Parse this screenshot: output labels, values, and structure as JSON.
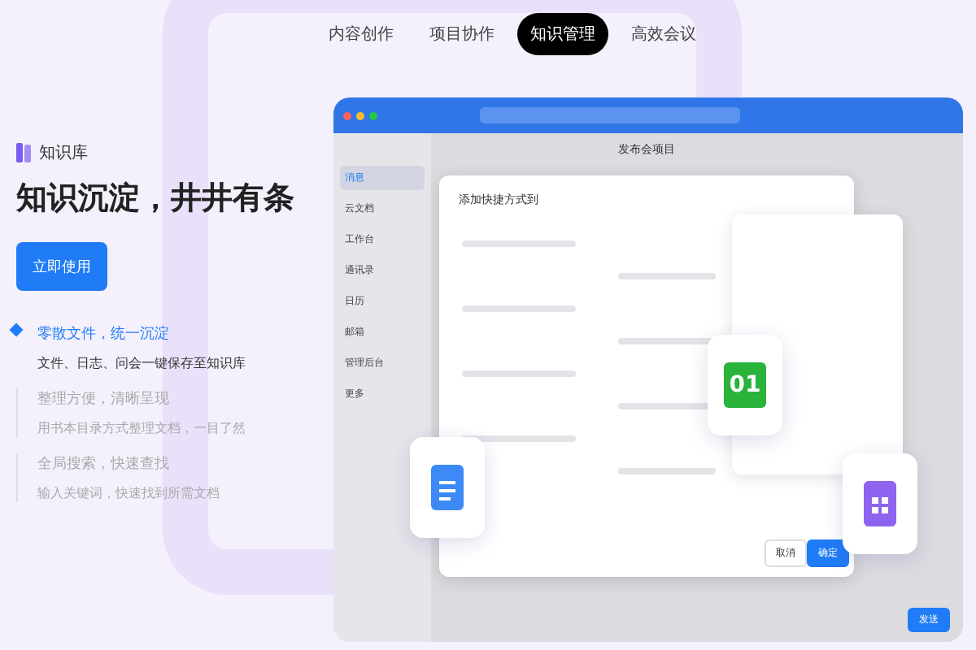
{
  "nav": [
    {
      "label": "内容创作",
      "selected": false
    },
    {
      "label": "项目协作",
      "selected": false
    },
    {
      "label": "知识管理",
      "selected": true
    },
    {
      "label": "高效会议",
      "selected": false
    }
  ],
  "product": {
    "name": "知识库"
  },
  "headline": "知识沉淀，井井有条",
  "cta": "立即使用",
  "features": [
    {
      "title": "零散文件，统一沉淀",
      "desc": "文件、日志、问会一键保存至知识库",
      "selected": true
    },
    {
      "title": "整理方便，清晰呈现",
      "desc": "用书本目录方式整理文档，一目了然",
      "selected": false
    },
    {
      "title": "全局搜索，快速查找",
      "desc": "输入关键词，快速找到所需文档",
      "selected": false
    }
  ],
  "app": {
    "sidebar": [
      {
        "label": "消息",
        "selected": true
      },
      {
        "label": "云文档",
        "selected": false
      },
      {
        "label": "工作台",
        "selected": false
      },
      {
        "label": "通讯录",
        "selected": false
      },
      {
        "label": "日历",
        "selected": false
      },
      {
        "label": "邮箱",
        "selected": false
      },
      {
        "label": "管理后台",
        "selected": false
      },
      {
        "label": "更多",
        "selected": false
      }
    ],
    "chat_title": "发布会项目",
    "dialog": {
      "title": "添加快捷方式到",
      "cancel": "取消",
      "confirm": "确定"
    },
    "tile_text": "01",
    "send": "发送"
  }
}
